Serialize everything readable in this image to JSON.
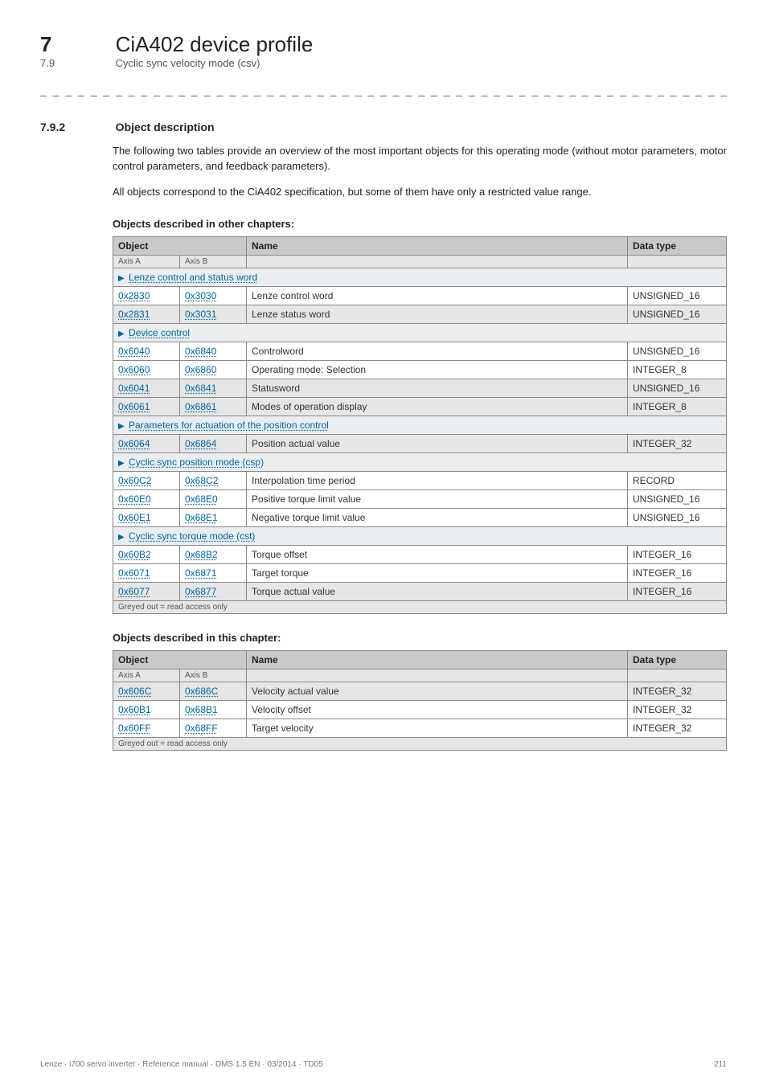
{
  "chapter": {
    "num": "7",
    "title": "CiA402 device profile"
  },
  "topSection": {
    "num": "7.9",
    "title": "Cyclic sync velocity mode (csv)"
  },
  "separator": "_ _ _ _ _ _ _ _ _ _ _ _ _ _ _ _ _ _ _ _ _ _ _ _ _ _ _ _ _ _ _ _ _ _ _ _ _ _ _ _ _ _ _ _ _ _ _ _ _ _ _ _ _ _ _ _ _ _ _ _ _ _ _ _",
  "section": {
    "num": "7.9.2",
    "title": "Object description"
  },
  "para1": "The following two tables provide an overview of the most important objects for this operating mode (without motor parameters, motor control parameters, and feedback parameters).",
  "para2": "All objects correspond to the CiA402 specification, but some of them have only a restricted value range.",
  "t1": {
    "caption": "Objects described in other chapters:",
    "head": {
      "object": "Object",
      "name": "Name",
      "type": "Data type"
    },
    "sub": {
      "a": "Axis A",
      "b": "Axis B"
    },
    "groups": [
      {
        "label": "Lenze control and status word",
        "rows": [
          {
            "a": "0x2830",
            "b": "0x3030",
            "name": "Lenze control word",
            "type": "UNSIGNED_16",
            "grey": false
          },
          {
            "a": "0x2831",
            "b": "0x3031",
            "name": "Lenze status word",
            "type": "UNSIGNED_16",
            "grey": true
          }
        ]
      },
      {
        "label": "Device control",
        "rows": [
          {
            "a": "0x6040",
            "b": "0x6840",
            "name": "Controlword",
            "type": "UNSIGNED_16",
            "grey": false
          },
          {
            "a": "0x6060",
            "b": "0x6860",
            "name": "Operating mode: Selection",
            "type": "INTEGER_8",
            "grey": false
          },
          {
            "a": "0x6041",
            "b": "0x6841",
            "name": "Statusword",
            "type": "UNSIGNED_16",
            "grey": true
          },
          {
            "a": "0x6061",
            "b": "0x6861",
            "name": "Modes of operation display",
            "type": "INTEGER_8",
            "grey": true
          }
        ]
      },
      {
        "label": "Parameters for actuation of the position control",
        "rows": [
          {
            "a": "0x6064",
            "b": "0x6864",
            "name": "Position actual value",
            "type": "INTEGER_32",
            "grey": true
          }
        ]
      },
      {
        "label": "Cyclic sync position mode (csp)",
        "rows": [
          {
            "a": "0x60C2",
            "b": "0x68C2",
            "name": "Interpolation time period",
            "type": "RECORD",
            "grey": false
          },
          {
            "a": "0x60E0",
            "b": "0x68E0",
            "name": "Positive torque limit value",
            "type": "UNSIGNED_16",
            "grey": false
          },
          {
            "a": "0x60E1",
            "b": "0x68E1",
            "name": "Negative torque limit value",
            "type": "UNSIGNED_16",
            "grey": false
          }
        ]
      },
      {
        "label": "Cyclic sync torque mode (cst)",
        "rows": [
          {
            "a": "0x60B2",
            "b": "0x68B2",
            "name": "Torque offset",
            "type": "INTEGER_16",
            "grey": false
          },
          {
            "a": "0x6071",
            "b": "0x6871",
            "name": "Target torque",
            "type": "INTEGER_16",
            "grey": false
          },
          {
            "a": "0x6077",
            "b": "0x6877",
            "name": "Torque actual value",
            "type": "INTEGER_16",
            "grey": true
          }
        ]
      }
    ],
    "footnote": "Greyed out = read access only"
  },
  "t2": {
    "caption": "Objects described in this chapter:",
    "head": {
      "object": "Object",
      "name": "Name",
      "type": "Data type"
    },
    "sub": {
      "a": "Axis A",
      "b": "Axis B"
    },
    "rows": [
      {
        "a": "0x606C",
        "b": "0x686C",
        "name": "Velocity actual value",
        "type": "INTEGER_32",
        "grey": true
      },
      {
        "a": "0x60B1",
        "b": "0x68B1",
        "name": "Velocity offset",
        "type": "INTEGER_32",
        "grey": false
      },
      {
        "a": "0x60FF",
        "b": "0x68FF",
        "name": "Target velocity",
        "type": "INTEGER_32",
        "grey": false
      }
    ],
    "footnote": "Greyed out = read access only"
  },
  "footer": {
    "left": "Lenze · i700 servo inverter · Reference manual · DMS 1.5 EN · 03/2014 · TD05",
    "right": "211"
  }
}
